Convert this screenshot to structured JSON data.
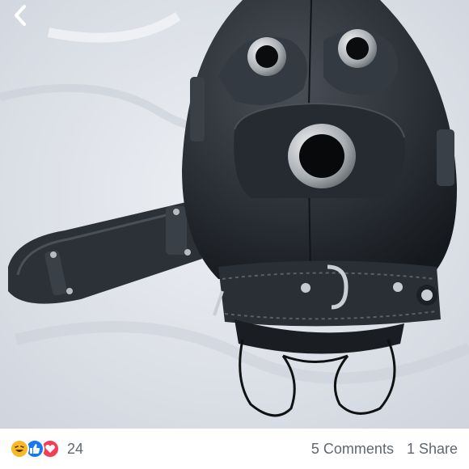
{
  "nav": {
    "back_icon": "chevron-left-icon"
  },
  "photo": {
    "subject": ""
  },
  "footer": {
    "reactions": [
      "laugh-reaction-icon",
      "like-reaction-icon",
      "love-reaction-icon"
    ],
    "reaction_count": "24",
    "comments": "5 Comments",
    "shares": "1 Share"
  },
  "colors": {
    "like_blue": "#1877f2",
    "love_red": "#f33e58",
    "haha_yellow": "#f7b928",
    "meta_text": "#606770"
  }
}
